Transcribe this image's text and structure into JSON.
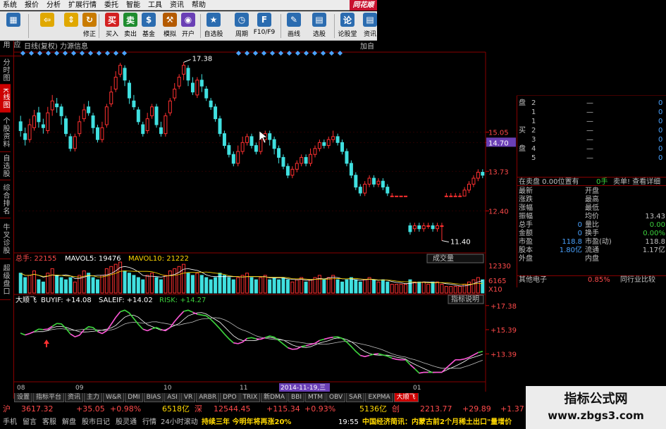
{
  "menu": [
    "系统",
    "报价",
    "分析",
    "扩展行情",
    "委托",
    "智能",
    "工具",
    "资讯",
    "帮助"
  ],
  "brand": "同花顺",
  "toolbar": [
    {
      "label": "",
      "icon": "grid-icon",
      "color": "#2b6cb0"
    },
    {
      "label": "",
      "icon": "back-arrow-icon",
      "color": "#e0a800"
    },
    {
      "label": "",
      "icon": "up-down-arrows-icon",
      "color": "#e0a800"
    },
    {
      "label": "修正",
      "icon": "refresh-icon",
      "color": "#c97b00"
    },
    {
      "label": "买入",
      "icon": "buy-icon",
      "color": "#d32020"
    },
    {
      "label": "卖出",
      "icon": "sell-icon",
      "color": "#1e8c2e"
    },
    {
      "label": "基金",
      "icon": "fund-icon",
      "color": "#2b6cb0"
    },
    {
      "label": "模拟",
      "icon": "hammer-icon",
      "color": "#b45a00"
    },
    {
      "label": "开户",
      "icon": "account-icon",
      "color": "#6a3fb5"
    },
    {
      "label": "自选股",
      "icon": "star-icon",
      "color": "#2b6cb0"
    },
    {
      "label": "周期",
      "icon": "clock-icon",
      "color": "#2b6cb0"
    },
    {
      "label": "F10/F9",
      "icon": "f10-icon",
      "color": "#2b6cb0"
    },
    {
      "label": "画线",
      "icon": "pencil-icon",
      "color": "#2b6cb0"
    },
    {
      "label": "选股",
      "icon": "filter-icon",
      "color": "#2b6cb0"
    },
    {
      "label": "论股堂",
      "icon": "discuss-icon",
      "color": "#2b6cb0"
    },
    {
      "label": "资讯",
      "icon": "news-icon",
      "color": "#2b6cb0"
    }
  ],
  "sidebar": [
    "应用",
    "分时图",
    "K线图",
    "个股资料",
    "自选股",
    "综合排名",
    "牛叉诊股",
    "超级盘口"
  ],
  "sidebar_active": 2,
  "chart": {
    "header_left": "日线(复权)  力源信息",
    "header_right": "加自",
    "price_labels": [
      "15.05",
      "14.70",
      "13.73",
      "12.40"
    ],
    "current_price": "14.70",
    "high_mark": "17.38",
    "low_mark": "11.40",
    "volume_header": {
      "label": "总手: 22155",
      "mavol5": "MAVOL5: 19476",
      "mavol10": "MAVOL10: 21222"
    },
    "volume_button": "成交量",
    "volume_scale": [
      "12330",
      "6165",
      "X10"
    ],
    "indicator_header": {
      "name": "大顺飞",
      "buy": "BUYIF: +14.08",
      "sale": "SALEIF: +14.02",
      "risk": "RISK: +14.27"
    },
    "indicator_button": "指标说明",
    "indicator_scale": [
      "+17.38",
      "+15.39",
      "+13.39"
    ],
    "date_labels": [
      "08",
      "09",
      "10",
      "11",
      "2014-11-19,三",
      "01"
    ]
  },
  "chart_data": {
    "type": "candlestick",
    "title": "日线(复权) 力源信息",
    "ylim": [
      11.4,
      17.38
    ],
    "candles": [
      [
        15.4,
        15.1,
        15.6,
        14.9
      ],
      [
        15.0,
        14.8,
        15.2,
        14.6
      ],
      [
        14.8,
        15.3,
        15.5,
        14.7
      ],
      [
        15.2,
        15.6,
        15.8,
        15.1
      ],
      [
        15.7,
        15.4,
        15.9,
        15.2
      ],
      [
        15.3,
        15.2,
        15.5,
        15.0
      ],
      [
        15.1,
        15.7,
        15.9,
        15.0
      ],
      [
        15.8,
        16.1,
        16.3,
        15.6
      ],
      [
        16.0,
        15.9,
        16.2,
        15.7
      ],
      [
        15.9,
        15.6,
        16.0,
        15.3
      ],
      [
        15.5,
        15.0,
        15.6,
        14.9
      ],
      [
        14.9,
        14.5,
        15.0,
        14.4
      ],
      [
        14.5,
        14.9,
        15.0,
        14.4
      ],
      [
        15.0,
        15.4,
        15.6,
        14.9
      ],
      [
        15.5,
        15.8,
        16.0,
        15.4
      ],
      [
        15.9,
        15.7,
        16.1,
        15.6
      ],
      [
        15.6,
        15.2,
        15.7,
        15.0
      ],
      [
        15.2,
        14.8,
        15.3,
        14.7
      ],
      [
        14.8,
        15.2,
        15.4,
        14.7
      ],
      [
        15.3,
        15.9,
        16.0,
        15.2
      ],
      [
        16.0,
        16.4,
        16.6,
        15.9
      ],
      [
        16.5,
        16.9,
        17.1,
        16.4
      ],
      [
        17.0,
        17.3,
        17.38,
        16.9
      ],
      [
        17.2,
        16.8,
        17.3,
        16.6
      ],
      [
        16.7,
        16.2,
        16.8,
        16.0
      ],
      [
        16.1,
        15.9,
        16.3,
        15.8
      ],
      [
        15.8,
        15.4,
        15.9,
        15.3
      ],
      [
        15.3,
        15.0,
        15.4,
        14.9
      ],
      [
        15.1,
        15.5,
        15.7,
        15.0
      ],
      [
        15.6,
        15.9,
        16.0,
        15.5
      ],
      [
        15.9,
        15.3,
        16.0,
        15.2
      ],
      [
        15.2,
        15.0,
        15.4,
        14.9
      ],
      [
        15.0,
        15.6,
        15.7,
        14.9
      ],
      [
        15.7,
        16.1,
        16.2,
        15.6
      ],
      [
        16.2,
        16.5,
        16.7,
        16.1
      ],
      [
        16.6,
        16.9,
        17.0,
        16.5
      ],
      [
        17.0,
        17.3,
        17.4,
        16.8
      ],
      [
        17.2,
        16.8,
        17.3,
        16.6
      ],
      [
        16.7,
        16.4,
        16.9,
        16.3
      ],
      [
        16.3,
        16.8,
        16.9,
        16.2
      ],
      [
        16.8,
        16.6,
        17.0,
        16.4
      ],
      [
        16.5,
        16.2,
        16.6,
        16.1
      ],
      [
        16.1,
        15.9,
        16.2,
        15.8
      ],
      [
        15.9,
        15.5,
        16.0,
        15.4
      ],
      [
        15.5,
        15.0,
        15.6,
        14.9
      ],
      [
        15.0,
        14.6,
        15.1,
        14.5
      ],
      [
        14.6,
        14.3,
        14.7,
        14.2
      ],
      [
        14.3,
        14.0,
        14.4,
        13.9
      ],
      [
        14.0,
        14.4,
        14.6,
        13.9
      ],
      [
        14.4,
        14.7,
        14.9,
        14.3
      ],
      [
        14.7,
        14.9,
        15.0,
        14.6
      ],
      [
        14.9,
        14.6,
        15.0,
        14.5
      ],
      [
        14.6,
        14.4,
        14.7,
        14.3
      ],
      [
        14.4,
        14.8,
        15.0,
        14.3
      ],
      [
        14.8,
        15.0,
        15.1,
        14.7
      ],
      [
        15.0,
        14.8,
        15.1,
        14.6
      ],
      [
        14.8,
        14.5,
        14.9,
        14.3
      ],
      [
        14.5,
        14.2,
        14.6,
        14.0
      ],
      [
        14.2,
        13.9,
        14.3,
        13.8
      ],
      [
        13.9,
        13.6,
        14.0,
        13.5
      ],
      [
        13.6,
        13.8,
        13.9,
        13.5
      ],
      [
        13.8,
        14.0,
        14.1,
        13.7
      ],
      [
        14.0,
        14.2,
        14.3,
        13.9
      ],
      [
        14.2,
        14.0,
        14.3,
        13.9
      ],
      [
        14.0,
        14.3,
        14.5,
        13.9
      ],
      [
        14.3,
        14.5,
        14.6,
        14.2
      ],
      [
        14.5,
        14.7,
        14.8,
        14.4
      ],
      [
        14.7,
        14.6,
        14.8,
        14.5
      ],
      [
        14.6,
        14.8,
        14.9,
        14.5
      ],
      [
        14.8,
        14.9,
        15.1,
        14.7
      ],
      [
        14.9,
        14.7,
        15.0,
        14.6
      ],
      [
        14.7,
        14.4,
        14.8,
        14.3
      ],
      [
        14.4,
        14.0,
        14.5,
        13.9
      ],
      [
        14.0,
        13.6,
        14.1,
        13.5
      ],
      [
        13.6,
        13.2,
        13.7,
        13.1
      ],
      [
        13.2,
        13.0,
        13.3,
        12.9
      ],
      [
        13.0,
        13.3,
        13.4,
        12.9
      ],
      [
        13.3,
        13.5,
        13.6,
        13.2
      ],
      [
        13.5,
        13.3,
        13.6,
        13.2
      ],
      [
        13.3,
        13.4,
        13.5,
        13.2
      ],
      [
        13.4,
        13.2,
        13.5,
        13.1
      ],
      [
        13.2,
        13.0,
        13.3,
        12.9
      ],
      [
        12.9,
        12.9,
        13.0,
        12.9
      ],
      [
        12.9,
        12.9,
        12.9,
        12.9
      ],
      [
        12.9,
        12.9,
        12.9,
        12.9
      ],
      [
        12.9,
        12.9,
        12.9,
        12.9
      ],
      [
        11.9,
        11.7,
        12.0,
        11.6
      ],
      [
        11.8,
        11.9,
        12.0,
        11.7
      ],
      [
        11.9,
        11.8,
        12.0,
        11.7
      ],
      [
        11.8,
        11.9,
        12.0,
        11.7
      ],
      [
        11.9,
        11.9,
        12.0,
        11.8
      ],
      [
        11.9,
        11.8,
        12.0,
        11.7
      ],
      [
        11.8,
        11.9,
        12.0,
        11.7
      ],
      [
        11.9,
        11.9,
        12.0,
        11.4
      ],
      [
        12.9,
        12.9,
        13.0,
        12.9
      ],
      [
        12.9,
        12.9,
        13.0,
        12.9
      ],
      [
        12.9,
        12.9,
        13.0,
        12.9
      ],
      [
        12.9,
        12.9,
        13.0,
        12.9
      ],
      [
        12.9,
        13.1,
        13.2,
        12.9
      ],
      [
        13.1,
        13.3,
        13.4,
        13.0
      ],
      [
        13.3,
        13.5,
        13.6,
        13.2
      ],
      [
        13.5,
        13.7,
        13.8,
        13.4
      ],
      [
        13.7,
        13.6,
        13.8,
        13.5
      ]
    ],
    "volume": [
      9,
      7,
      8,
      10,
      6,
      5,
      9,
      11,
      8,
      7,
      6,
      7,
      5,
      8,
      10,
      9,
      7,
      6,
      8,
      11,
      12,
      13,
      14,
      10,
      9,
      8,
      7,
      6,
      8,
      9,
      7,
      6,
      8,
      10,
      11,
      12,
      13,
      9,
      8,
      9,
      8,
      7,
      6,
      7,
      9,
      8,
      7,
      6,
      7,
      8,
      9,
      7,
      6,
      7,
      8,
      6,
      7,
      6,
      7,
      6,
      5,
      6,
      7,
      5,
      6,
      7,
      8,
      6,
      7,
      8,
      6,
      5,
      6,
      7,
      6,
      5,
      6,
      7,
      6,
      5,
      6,
      5,
      4,
      4,
      4,
      4,
      6,
      5,
      5,
      5,
      4,
      5,
      5,
      4,
      3,
      3,
      3,
      3,
      4,
      5,
      6,
      7,
      6
    ]
  },
  "quote": {
    "orderbook": [
      {
        "side": "盘",
        "lvl": "2",
        "price": "—",
        "vol": "0"
      },
      {
        "side": "",
        "lvl": "1",
        "price": "—",
        "vol": "0"
      },
      {
        "side": "",
        "lvl": "1",
        "price": "—",
        "vol": "0"
      },
      {
        "side": "买",
        "lvl": "2",
        "price": "—",
        "vol": "0"
      },
      {
        "side": "",
        "lvl": "3",
        "price": "—",
        "vol": "0"
      },
      {
        "side": "盘",
        "lvl": "4",
        "price": "—",
        "vol": "0"
      },
      {
        "side": "",
        "lvl": "5",
        "price": "—",
        "vol": "0"
      }
    ],
    "sell_line": {
      "left": "在卖盘 0.00位置有",
      "mid": "0手",
      "right": "卖单! 查看详细"
    },
    "stats": [
      {
        "l": "最新",
        "lv": "",
        "r": "开盘",
        "rv": ""
      },
      {
        "l": "涨跌",
        "lv": "",
        "r": "最高",
        "rv": ""
      },
      {
        "l": "涨幅",
        "lv": "",
        "r": "最低",
        "rv": ""
      },
      {
        "l": "振幅",
        "lv": "",
        "r": "均价",
        "rv": "13.43"
      },
      {
        "l": "总手",
        "lv": "0",
        "r": "量比",
        "rv": "0.00"
      },
      {
        "l": "金额",
        "lv": "0",
        "r": "换手",
        "rv": "0.00%"
      },
      {
        "l": "市盈",
        "lv": "118.8",
        "r": "市盈(动)",
        "rv": "118.8"
      },
      {
        "l": "股本",
        "lv": "1.80亿",
        "r": "流通",
        "rv": "1.17亿"
      },
      {
        "l": "外盘",
        "lv": "",
        "r": "内盘",
        "rv": ""
      }
    ],
    "sector": {
      "name": "其他电子",
      "pct": "0.85%",
      "link": "同行业比较"
    }
  },
  "bottom_tabs": [
    "设置",
    "指标平台",
    "资讯",
    "主力",
    "W&R",
    "DMI",
    "BIAS",
    "ASI",
    "VR",
    "ARBR",
    "DPO",
    "TRIX",
    "新DMA",
    "BBI",
    "MTM",
    "OBV",
    "SAR",
    "EXPMA",
    "大顺飞"
  ],
  "bottom_active": 18,
  "index_bar": {
    "sh_label": "沪",
    "sh_val": "3617.32",
    "sh_chg": "+35.05",
    "sh_pct": "+0.98%",
    "sh_amt": "6518亿",
    "sz_label": "深",
    "sz_val": "12544.45",
    "sz_chg": "+115.34",
    "sz_pct": "+0.93%",
    "sz_amt": "5136亿",
    "cy_label": "创",
    "cy_val": "2213.77",
    "cy_chg": "+29.89",
    "cy_pct": "+1.37"
  },
  "footer": {
    "left": [
      "手机",
      "留言",
      "客服",
      "解盘",
      "股市日记",
      "股灵通",
      "行情"
    ],
    "ticker_label": "24小时滚动",
    "ticker": "持续三年 今明年将再涨20%",
    "time": "19:55",
    "news": "中国经济简讯：内蒙古前2个月稀土出口\"量增价"
  },
  "watermark": {
    "title": "指标公式网",
    "url": "www.zbgs3.com"
  }
}
